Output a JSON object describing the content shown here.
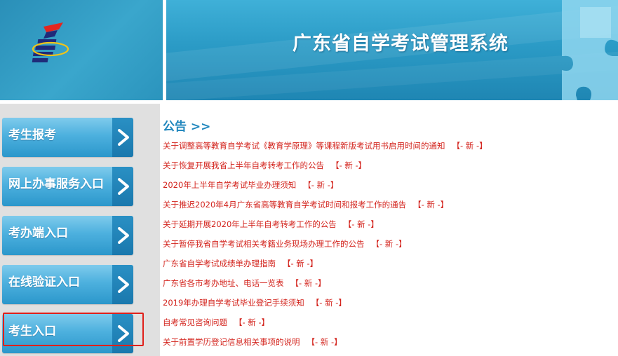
{
  "header": {
    "title": "广东省自学考试管理系统"
  },
  "sidebar": {
    "items": [
      {
        "label": "考生报考"
      },
      {
        "label": "网上办事服务入口"
      },
      {
        "label": "考办端入口"
      },
      {
        "label": "在线验证入口"
      },
      {
        "label": "考生入口"
      }
    ]
  },
  "notices": {
    "title": "公告 >>",
    "new_tag": "【- 新 -】",
    "items": [
      {
        "text": "关于调整高等教育自学考试《教育学原理》等课程新版考试用书启用时间的通知"
      },
      {
        "text": "关于恢复开展我省上半年自考转考工作的公告"
      },
      {
        "text": "2020年上半年自学考试毕业办理须知"
      },
      {
        "text": "关于推迟2020年4月广东省高等教育自学考试时间和报考工作的通告"
      },
      {
        "text": "关于延期开展2020年上半年自考转考工作的公告"
      },
      {
        "text": "关于暂停我省自学考试相关考籍业务现场办理工作的公告"
      },
      {
        "text": "广东省自学考试成绩单办理指南"
      },
      {
        "text": "广东省各市考办地址、电话一览表"
      },
      {
        "text": "2019年办理自学考试毕业登记手续须知"
      },
      {
        "text": "自考常见咨询问题"
      },
      {
        "text": "关于前置学历登记信息相关事项的说明"
      }
    ]
  },
  "colors": {
    "accent": "#2b97cb",
    "notice_red": "#d3231c",
    "title_blue": "#1f86bd",
    "highlight": "#e0201a"
  }
}
